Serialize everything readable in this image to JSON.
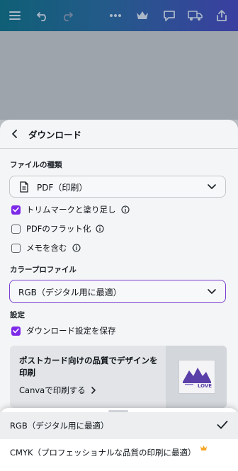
{
  "toolbar": {
    "icons": [
      "menu-icon",
      "undo-icon",
      "redo-icon",
      "more-icon",
      "crown-icon",
      "comment-icon",
      "truck-icon",
      "share-icon"
    ],
    "brand_gradient": [
      "#0f5f76",
      "#3a3fa0"
    ]
  },
  "sheet": {
    "title": "ダウンロード",
    "file_type_label": "ファイルの種類",
    "file_type_value": "PDF（印刷）",
    "options": [
      {
        "label": "トリムマークと塗り足し",
        "checked": true,
        "info": true
      },
      {
        "label": "PDFのフラット化",
        "checked": false,
        "info": true
      },
      {
        "label": "メモを含む",
        "checked": false,
        "info": true
      }
    ],
    "color_profile_label": "カラープロファイル",
    "color_profile_value": "RGB（デジタル用に最適）",
    "settings_label": "設定",
    "save_settings_label": "ダウンロード設定を保存",
    "save_settings_checked": true
  },
  "promo": {
    "title": "ポストカード向けの品質でデザインを印刷",
    "link": "Canvaで印刷する",
    "thumb_text": "LOVE"
  },
  "menu": {
    "items": [
      {
        "label": "RGB（デジタル用に最適）",
        "selected": true
      },
      {
        "label": "CMYK（プロフェッショナルな品質の印刷に最適）",
        "selected": false,
        "premium": true
      }
    ]
  },
  "colors": {
    "accent": "#7d2ae8",
    "crown": "#f5a623"
  }
}
